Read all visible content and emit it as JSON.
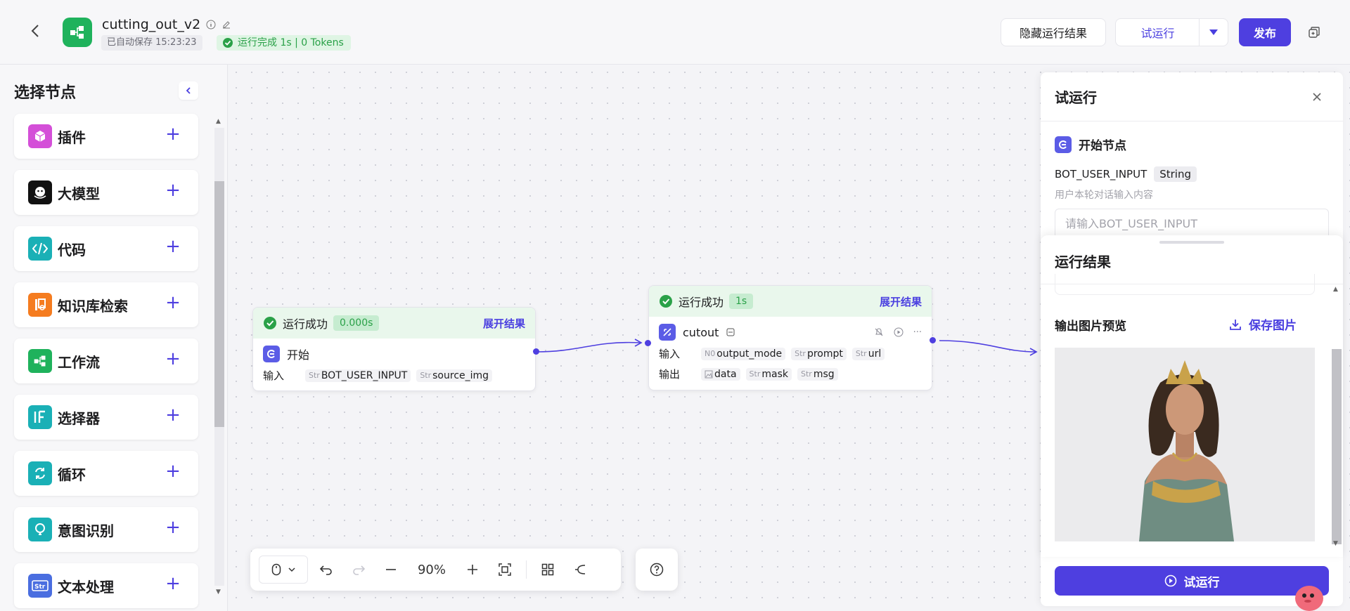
{
  "header": {
    "title": "cutting_out_v2",
    "autosave": "已自动保存 15:23:23",
    "run_status": "运行完成 1s | 0 Tokens",
    "hide_results": "隐藏运行结果",
    "trial_run": "试运行",
    "publish": "发布"
  },
  "sidebar": {
    "title": "选择节点",
    "items": [
      {
        "label": "插件",
        "icon": "cube-icon",
        "color": "#d44fd8"
      },
      {
        "label": "大模型",
        "icon": "llm-icon",
        "color": "#111111"
      },
      {
        "label": "代码",
        "icon": "code-icon",
        "color": "#1ab0b6"
      },
      {
        "label": "知识库检索",
        "icon": "knowledge-icon",
        "color": "#f57c1f"
      },
      {
        "label": "工作流",
        "icon": "workflow-icon",
        "color": "#1fb25c"
      },
      {
        "label": "选择器",
        "icon": "if-icon",
        "color": "#1ab0b6"
      },
      {
        "label": "循环",
        "icon": "loop-icon",
        "color": "#1ab0b6"
      },
      {
        "label": "意图识别",
        "icon": "intent-icon",
        "color": "#1ab0b6"
      },
      {
        "label": "文本处理",
        "icon": "text-icon",
        "color": "#4a6ee0"
      }
    ]
  },
  "nodes": {
    "start": {
      "status": "运行成功",
      "time": "0.000s",
      "expand": "展开结果",
      "name": "开始",
      "input_label": "输入",
      "inputs": [
        {
          "type": "Str",
          "name": "BOT_USER_INPUT"
        },
        {
          "type": "Str",
          "name": "source_img"
        }
      ]
    },
    "cutout": {
      "status": "运行成功",
      "time": "1s",
      "expand": "展开结果",
      "name": "cutout",
      "input_label": "输入",
      "output_label": "输出",
      "inputs": [
        {
          "type": "N0",
          "name": "output_mode"
        },
        {
          "type": "Str",
          "name": "prompt"
        },
        {
          "type": "Str",
          "name": "url"
        }
      ],
      "outputs": [
        {
          "type": "img",
          "name": "data"
        },
        {
          "type": "Str",
          "name": "mask"
        },
        {
          "type": "Str",
          "name": "msg"
        }
      ]
    }
  },
  "toolbar": {
    "zoom": "90%"
  },
  "panel": {
    "title": "试运行",
    "start_node": "开始节点",
    "param_name": "BOT_USER_INPUT",
    "param_type": "String",
    "param_desc": "用户本轮对话输入内容",
    "param_placeholder": "请输入BOT_USER_INPUT",
    "results_title": "运行结果",
    "preview_label": "输出图片预览",
    "save_image": "保存图片",
    "run_button": "试运行"
  }
}
